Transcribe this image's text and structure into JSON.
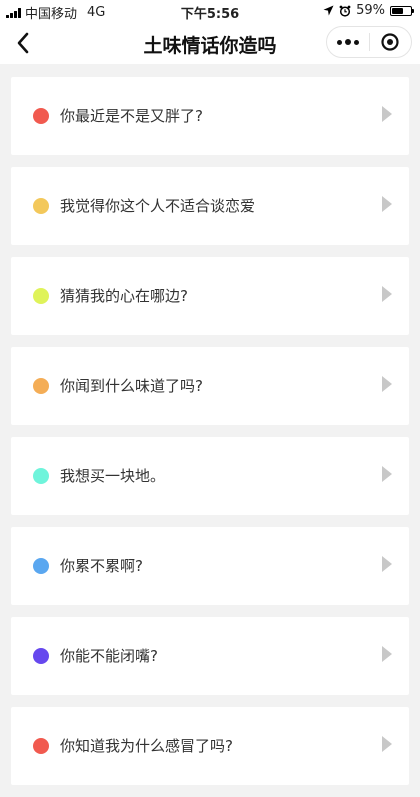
{
  "status_bar": {
    "carrier": "中国移动",
    "network": "4G",
    "time": "下午5:56",
    "battery_percent": "59%",
    "battery_level": 0.59
  },
  "nav": {
    "title": "土味情话你造吗",
    "back_icon": "chevron-left-icon",
    "more_icon": "more-dots-icon",
    "close_icon": "target-circle-icon"
  },
  "items": [
    {
      "label": "你最近是不是又胖了?",
      "color": "#f15a4f"
    },
    {
      "label": "我觉得你这个人不适合谈恋爱",
      "color": "#f3c85b"
    },
    {
      "label": "猜猜我的心在哪边?",
      "color": "#dff35a"
    },
    {
      "label": "你闻到什么味道了吗?",
      "color": "#f4ad56"
    },
    {
      "label": "我想买一块地。",
      "color": "#6ff4db"
    },
    {
      "label": "你累不累啊?",
      "color": "#5aa7f0"
    },
    {
      "label": "你能不能闭嘴?",
      "color": "#6648ee"
    },
    {
      "label": "你知道我为什么感冒了吗?",
      "color": "#f15a4f"
    }
  ]
}
